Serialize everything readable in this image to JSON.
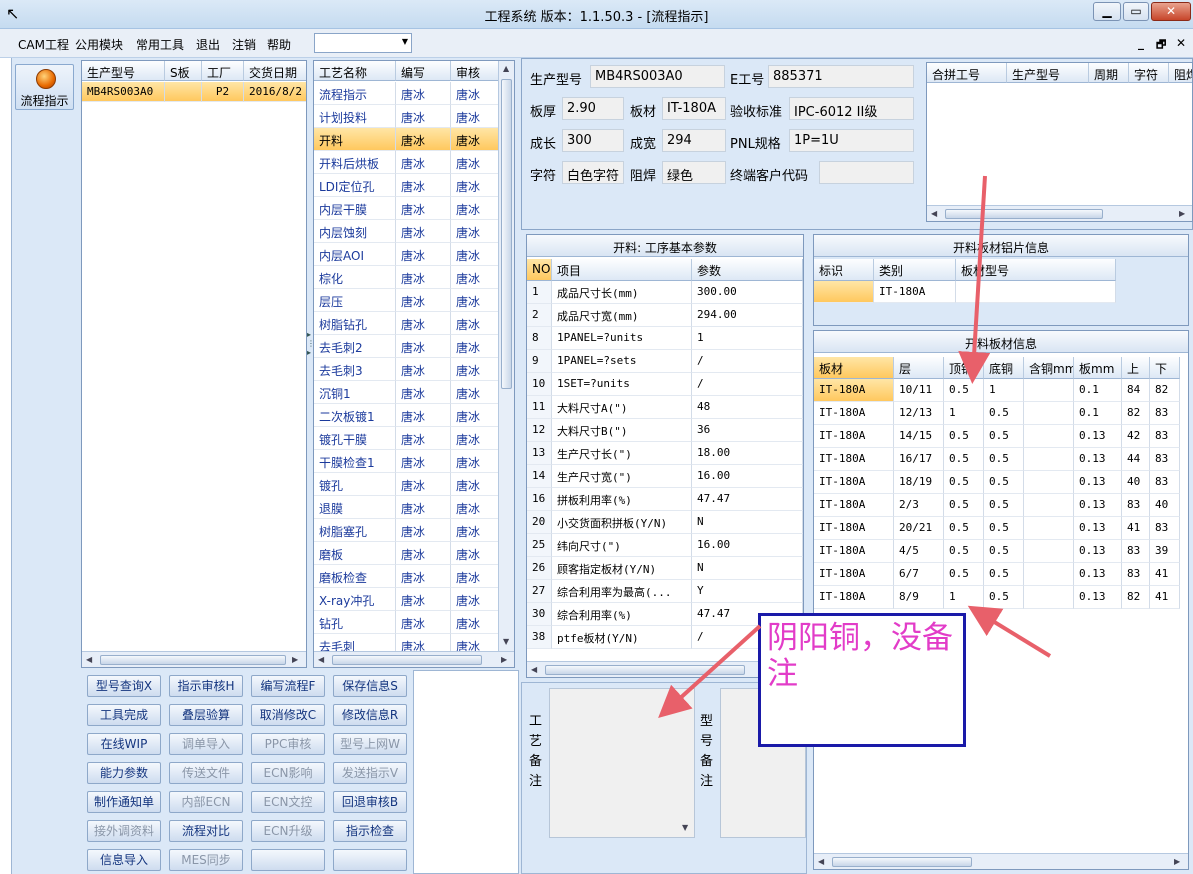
{
  "window": {
    "title": "工程系统   版本：1.1.50.3 - [流程指示]",
    "min": "▁",
    "max": "▭",
    "close": "✕"
  },
  "menu": [
    "CAM工程",
    "公用模块",
    "常用工具",
    "退出",
    "注销",
    "帮助"
  ],
  "mdi_controls": [
    "_",
    "🗗",
    "✕"
  ],
  "nav": {
    "flow_label": "流程指示"
  },
  "models": {
    "headers": [
      "生产型号",
      "S板",
      "工厂",
      "交货日期"
    ],
    "rows": [
      [
        "MB4RS003A0",
        "",
        "P2",
        "2016/8/2"
      ]
    ]
  },
  "process": {
    "headers": [
      "工艺名称",
      "编写",
      "审核"
    ],
    "rows": [
      [
        "流程指示",
        "唐冰",
        "唐冰"
      ],
      [
        "计划投料",
        "唐冰",
        "唐冰"
      ],
      [
        "开料",
        "唐冰",
        "唐冰"
      ],
      [
        "开料后烘板",
        "唐冰",
        "唐冰"
      ],
      [
        "LDI定位孔",
        "唐冰",
        "唐冰"
      ],
      [
        "内层干膜",
        "唐冰",
        "唐冰"
      ],
      [
        "内层蚀刻",
        "唐冰",
        "唐冰"
      ],
      [
        "内层AOI",
        "唐冰",
        "唐冰"
      ],
      [
        "棕化",
        "唐冰",
        "唐冰"
      ],
      [
        "层压",
        "唐冰",
        "唐冰"
      ],
      [
        "树脂钻孔",
        "唐冰",
        "唐冰"
      ],
      [
        "去毛刺2",
        "唐冰",
        "唐冰"
      ],
      [
        "去毛刺3",
        "唐冰",
        "唐冰"
      ],
      [
        "沉铜1",
        "唐冰",
        "唐冰"
      ],
      [
        "二次板镀1",
        "唐冰",
        "唐冰"
      ],
      [
        "镀孔干膜",
        "唐冰",
        "唐冰"
      ],
      [
        "干膜检查1",
        "唐冰",
        "唐冰"
      ],
      [
        "镀孔",
        "唐冰",
        "唐冰"
      ],
      [
        "退膜",
        "唐冰",
        "唐冰"
      ],
      [
        "树脂塞孔",
        "唐冰",
        "唐冰"
      ],
      [
        "磨板",
        "唐冰",
        "唐冰"
      ],
      [
        "磨板检查",
        "唐冰",
        "唐冰"
      ],
      [
        "X-ray冲孔",
        "唐冰",
        "唐冰"
      ],
      [
        "钻孔",
        "唐冰",
        "唐冰"
      ],
      [
        "去毛刺",
        "唐冰",
        "唐冰"
      ]
    ]
  },
  "buttons": [
    [
      [
        "型号查询X",
        1
      ],
      [
        "指示审核H",
        1
      ],
      [
        "编写流程F",
        1
      ],
      [
        "保存信息S",
        1
      ]
    ],
    [
      [
        "工具完成",
        1
      ],
      [
        "叠层验算",
        1
      ],
      [
        "取消修改C",
        1
      ],
      [
        "修改信息R",
        1
      ]
    ],
    [
      [
        "在线WIP",
        1
      ],
      [
        "调单导入",
        0
      ],
      [
        "PPC审核",
        0
      ],
      [
        "型号上网W",
        0
      ]
    ],
    [
      [
        "能力参数",
        1
      ],
      [
        "传送文件",
        0
      ],
      [
        "ECN影响",
        0
      ],
      [
        "发送指示V",
        0
      ]
    ],
    [
      [
        "制作通知单",
        1
      ],
      [
        "内部ECN",
        0
      ],
      [
        "ECN文控",
        0
      ],
      [
        "回退审核B",
        1
      ]
    ],
    [
      [
        "接外调资料",
        0
      ],
      [
        "流程对比",
        1
      ],
      [
        "ECN升级",
        0
      ],
      [
        "指示检查",
        1
      ]
    ],
    [
      [
        "信息导入",
        1
      ],
      [
        "MES同步",
        0
      ],
      [
        "",
        0
      ],
      [
        "",
        0
      ]
    ]
  ],
  "info": {
    "model_label": "生产型号",
    "model": "MB4RS003A0",
    "e_label": "E工号",
    "e": "885371",
    "thick_label": "板厚",
    "thick": "2.90",
    "mat_label": "板材",
    "mat": "IT-180A",
    "std_label": "验收标准",
    "std": "IPC-6012 II级",
    "len_label": "成长",
    "len": "300",
    "wid_label": "成宽",
    "wid": "294",
    "pnl_label": "PNL规格",
    "pnl": "1P=1U",
    "char_label": "字符",
    "char": "白色字符",
    "mask_label": "阻焊",
    "mask": "绿色",
    "cust_label": "终端客户代码",
    "cust": ""
  },
  "merge": {
    "headers": [
      "合拼工号",
      "生产型号",
      "周期",
      "字符",
      "阻焊"
    ]
  },
  "params": {
    "title": "开料: 工序基本参数",
    "headers": [
      "NO",
      "项目",
      "参数"
    ],
    "rows": [
      [
        "1",
        "成品尺寸长(mm)",
        "300.00"
      ],
      [
        "2",
        "成品尺寸宽(mm)",
        "294.00"
      ],
      [
        "8",
        "1PANEL=?units",
        "1"
      ],
      [
        "9",
        "1PANEL=?sets",
        "/"
      ],
      [
        "10",
        "1SET=?units",
        "/"
      ],
      [
        "11",
        "大料尺寸A(\")",
        "48"
      ],
      [
        "12",
        "大料尺寸B(\")",
        "36"
      ],
      [
        "13",
        "生产尺寸长(\")",
        "18.00"
      ],
      [
        "14",
        "生产尺寸宽(\")",
        "16.00"
      ],
      [
        "16",
        "拼板利用率(%)",
        "47.47"
      ],
      [
        "20",
        "小交货面积拼板(Y/N)",
        "N"
      ],
      [
        "25",
        "纬向尺寸(\")",
        "16.00"
      ],
      [
        "26",
        "顾客指定板材(Y/N)",
        "N"
      ],
      [
        "27",
        "综合利用率为最高(...",
        "Y"
      ],
      [
        "30",
        "综合利用率(%)",
        "47.47"
      ],
      [
        "38",
        "ptfe板材(Y/N)",
        "/"
      ]
    ]
  },
  "sheet": {
    "title": "开料板材铝片信息",
    "headers": [
      "标识",
      "类别",
      "板材型号"
    ],
    "rows": [
      [
        "",
        "IT-180A",
        ""
      ]
    ]
  },
  "material": {
    "title": "开料板材信息",
    "headers": [
      "板材",
      "层",
      "顶铜",
      "底铜",
      "含铜mm",
      "板mm",
      "上",
      "下"
    ],
    "rows": [
      [
        "IT-180A",
        "10/11",
        "0.5",
        "1",
        "",
        "0.1",
        "84",
        "82"
      ],
      [
        "IT-180A",
        "12/13",
        "1",
        "0.5",
        "",
        "0.1",
        "82",
        "83"
      ],
      [
        "IT-180A",
        "14/15",
        "0.5",
        "0.5",
        "",
        "0.13",
        "42",
        "83"
      ],
      [
        "IT-180A",
        "16/17",
        "0.5",
        "0.5",
        "",
        "0.13",
        "44",
        "83"
      ],
      [
        "IT-180A",
        "18/19",
        "0.5",
        "0.5",
        "",
        "0.13",
        "40",
        "83"
      ],
      [
        "IT-180A",
        "2/3",
        "0.5",
        "0.5",
        "",
        "0.13",
        "83",
        "40"
      ],
      [
        "IT-180A",
        "20/21",
        "0.5",
        "0.5",
        "",
        "0.13",
        "41",
        "83"
      ],
      [
        "IT-180A",
        "4/5",
        "0.5",
        "0.5",
        "",
        "0.13",
        "83",
        "39"
      ],
      [
        "IT-180A",
        "6/7",
        "0.5",
        "0.5",
        "",
        "0.13",
        "83",
        "41"
      ],
      [
        "IT-180A",
        "8/9",
        "1",
        "0.5",
        "",
        "0.13",
        "82",
        "41"
      ]
    ]
  },
  "notes": {
    "proc_label": "工\n艺\n备\n注",
    "model_label": "型\n号\n备\n注"
  },
  "annotation": {
    "text": "阴阳铜，没备注",
    "color": "#e23cc8",
    "arrow_color": "#e8606a"
  }
}
